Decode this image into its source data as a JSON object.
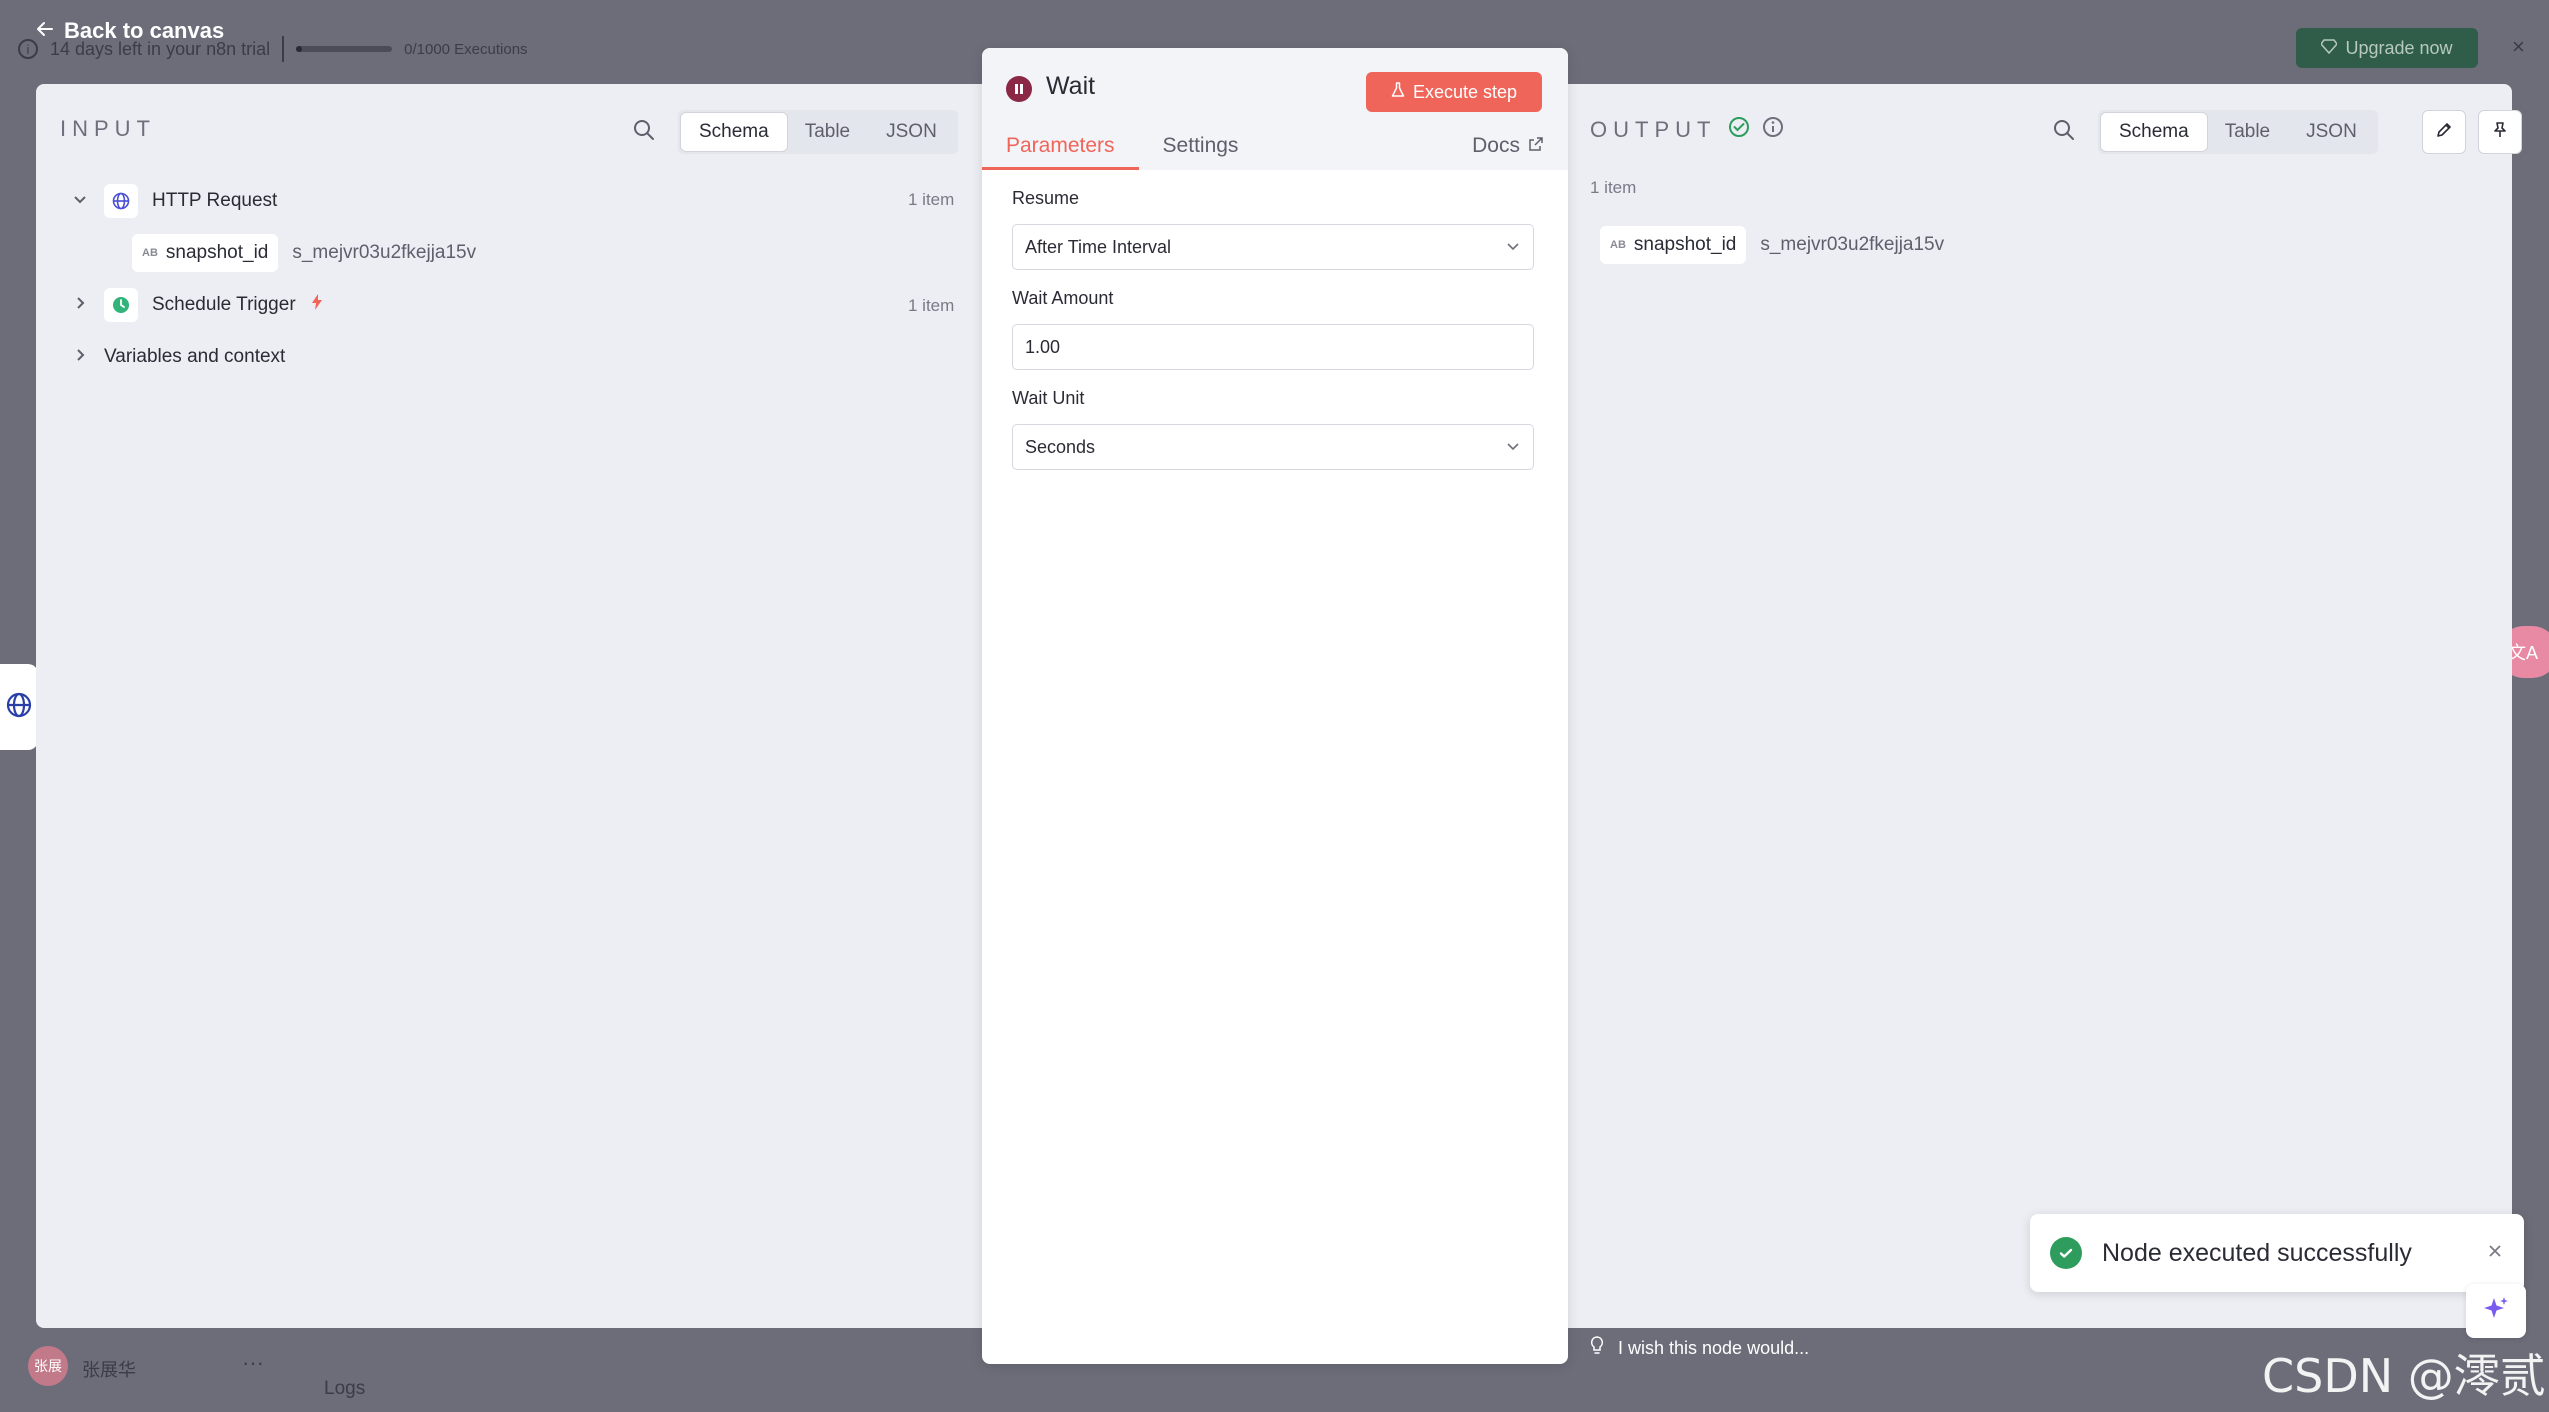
{
  "topbar": {
    "back_label": "Back to canvas",
    "trial_text": "14 days left in your n8n trial",
    "executions_text": "0/1000 Executions",
    "upgrade_label": "Upgrade now",
    "close_glyph": "×"
  },
  "input": {
    "title": "INPUT",
    "view_tabs": [
      "Schema",
      "Table",
      "JSON"
    ],
    "active_view": "Schema",
    "nodes": [
      {
        "label": "HTTP Request",
        "count": "1 item",
        "icon": "globe-icon",
        "expanded": true,
        "fields": [
          {
            "type": "AB",
            "name": "snapshot_id",
            "value": "s_mejvr03u2fkejja15v"
          }
        ]
      },
      {
        "label": "Schedule Trigger",
        "count": "1 item",
        "icon": "clock-icon",
        "expanded": false
      }
    ],
    "variables_label": "Variables and context"
  },
  "dialog": {
    "title": "Wait",
    "execute_label": "Execute step",
    "tabs": [
      "Parameters",
      "Settings"
    ],
    "active_tab": "Parameters",
    "docs_label": "Docs",
    "params": {
      "resume_label": "Resume",
      "resume_value": "After Time Interval",
      "amount_label": "Wait Amount",
      "amount_value": "1.00",
      "unit_label": "Wait Unit",
      "unit_value": "Seconds"
    }
  },
  "output": {
    "title": "OUTPUT",
    "view_tabs": [
      "Schema",
      "Table",
      "JSON"
    ],
    "active_view": "Schema",
    "item_count": "1 item",
    "fields": [
      {
        "type": "AB",
        "name": "snapshot_id",
        "value": "s_mejvr03u2fkejja15v"
      }
    ]
  },
  "toast": {
    "message": "Node executed successfully"
  },
  "footer": {
    "user_name": "张展华",
    "avatar_text": "张展",
    "more": "···",
    "logs_label": "Logs",
    "wish_text": "I wish this node would...",
    "watermark": "CSDN @澪贰",
    "translate_glyph": "文A"
  },
  "colors": {
    "accent": "#f0655a",
    "success": "#2e9c5d",
    "wait_node": "#8a2845",
    "panel_bg": "#eceef4"
  }
}
